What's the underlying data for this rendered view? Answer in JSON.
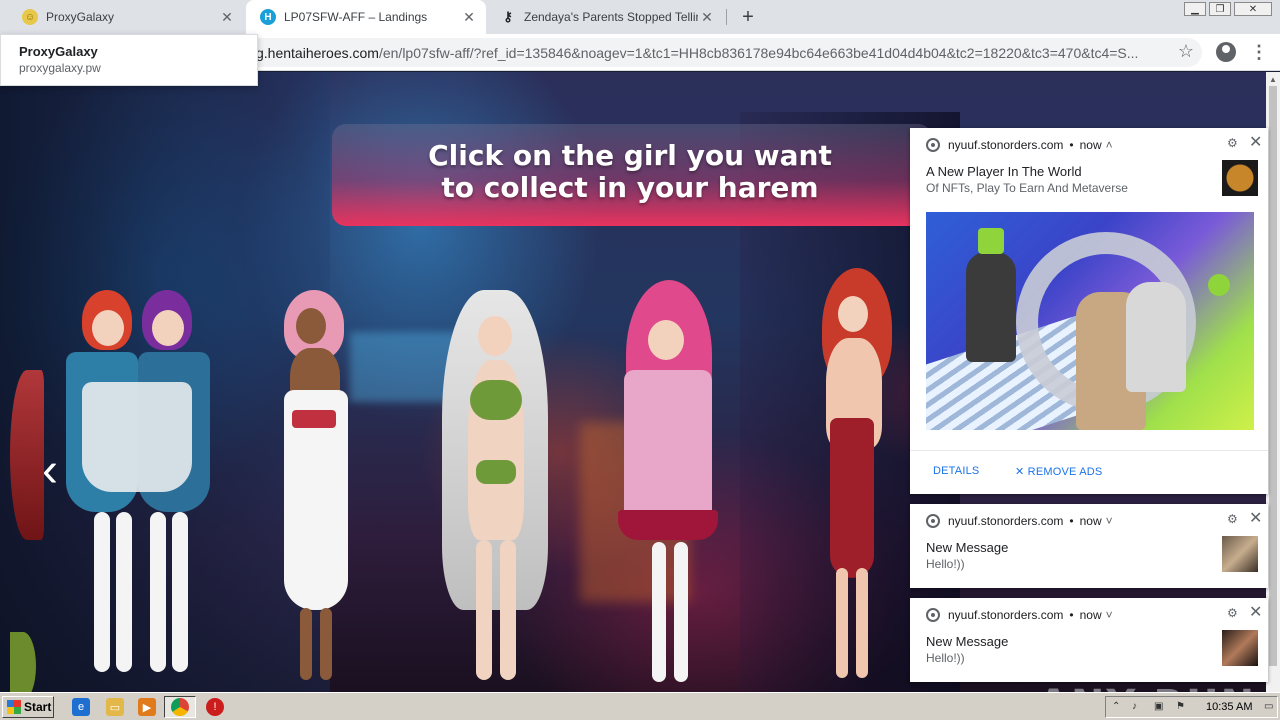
{
  "browser": {
    "tabs": [
      {
        "title": "ProxyGalaxy",
        "favicon": "smiley-icon",
        "active": false
      },
      {
        "title": "LP07SFW-AFF – Landings",
        "favicon": "hentaiheroes-icon",
        "active": true
      },
      {
        "title": "Zendaya's Parents Stopped Telling H",
        "favicon": "key-icon",
        "active": false
      }
    ],
    "new_tab_label": "+",
    "url_host": "g.hentaiheroes.com",
    "url_path": "/en/lp07sfw-aff/?ref_id=135846&noagev=1&tc1=HH8cb836178e94bc64e663be41d04d4b04&tc2=18220&tc3=470&tc4=S...",
    "hovercard": {
      "title": "ProxyGalaxy",
      "domain": "proxygalaxy.pw"
    }
  },
  "page": {
    "headline_line1": "Click on the girl you want",
    "headline_line2": "to collect in your harem",
    "prev_arrow": "‹",
    "colors": {
      "banner_bottom": "#e8335e",
      "headline": "#ffffff"
    }
  },
  "notifications": [
    {
      "source": "nyuuf.stonorders.com",
      "time": "now",
      "chevron": "˄",
      "title": "A New Player In The World",
      "body": "Of NFTs, Play To Earn And Metaverse",
      "actions": [
        "DETAILS",
        "✕ REMOVE ADS"
      ]
    },
    {
      "source": "nyuuf.stonorders.com",
      "time": "now",
      "chevron": "˅",
      "title": "New Message",
      "body": "Hello!))"
    },
    {
      "source": "nyuuf.stonorders.com",
      "time": "now",
      "chevron": "˅",
      "title": "New Message",
      "body": "Hello!))"
    }
  ],
  "watermark": "ANY RUN",
  "taskbar": {
    "start_label": "Start",
    "clock": "10:35 AM",
    "icons": [
      "ie-icon",
      "folder-icon",
      "media-player-icon",
      "chrome-icon",
      "stop-icon"
    ]
  }
}
